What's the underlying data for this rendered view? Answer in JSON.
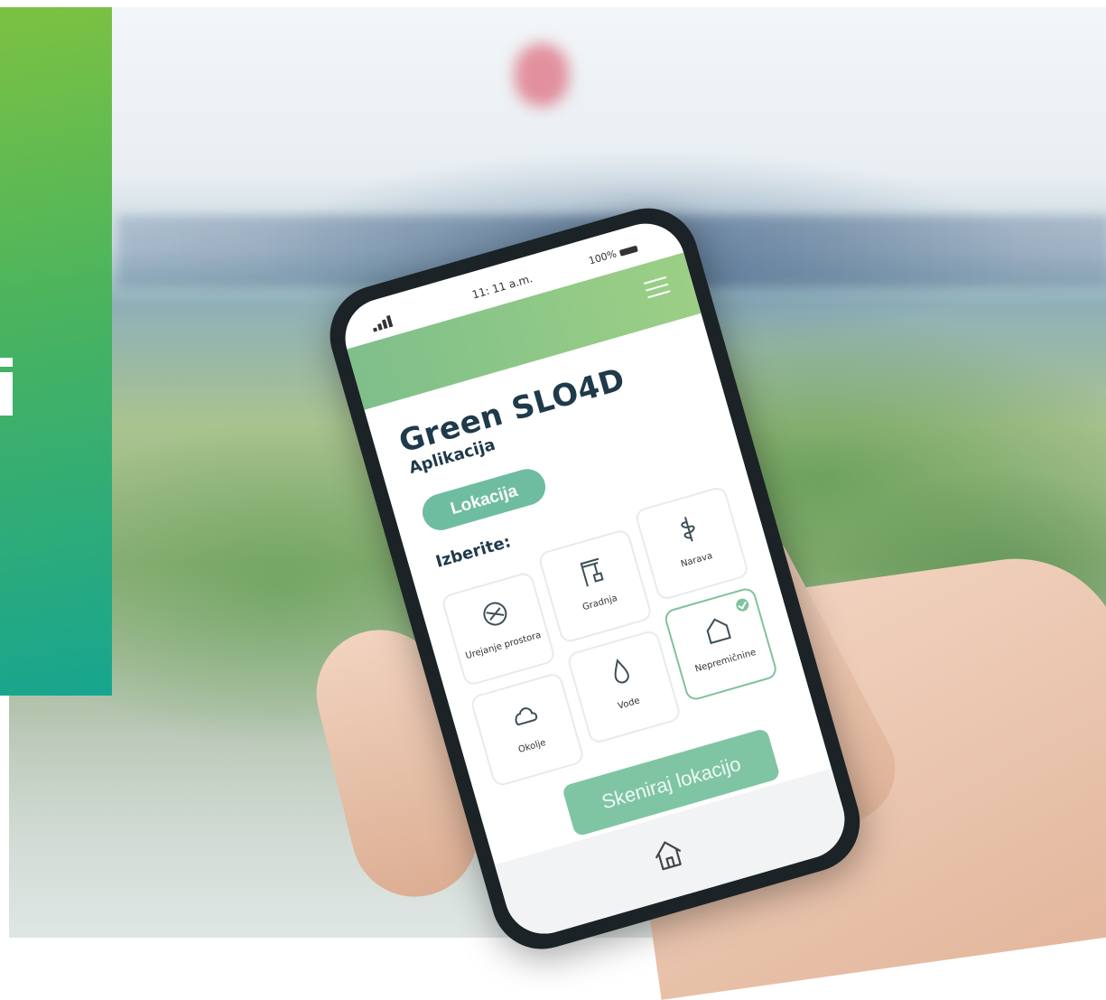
{
  "app": {
    "status_time": "11: 11 a.m.",
    "status_battery": "100%",
    "title": "Green SLO4D",
    "subtitle": "Aplikacija",
    "location_button": "Lokacija",
    "choose_label": "Izberite:",
    "tiles": [
      {
        "label": "Urejanje prostora",
        "icon": "spatial-planning-icon",
        "selected": false
      },
      {
        "label": "Gradnja",
        "icon": "crane-icon",
        "selected": false
      },
      {
        "label": "Narava",
        "icon": "leaf-icon",
        "selected": false
      },
      {
        "label": "Okolje",
        "icon": "cloud-icon",
        "selected": false
      },
      {
        "label": "Vode",
        "icon": "water-drop-icon",
        "selected": false
      },
      {
        "label": "Nepremičnine",
        "icon": "house-icon",
        "selected": true
      }
    ],
    "scan_button": "Skeniraj lokacijo"
  },
  "colors": {
    "accent_green": "#6fbda0",
    "header_green": "#8cc686",
    "panel_gradient_start": "#7cc242",
    "panel_gradient_end": "#17a58f",
    "title_navy": "#1f3a4a"
  }
}
